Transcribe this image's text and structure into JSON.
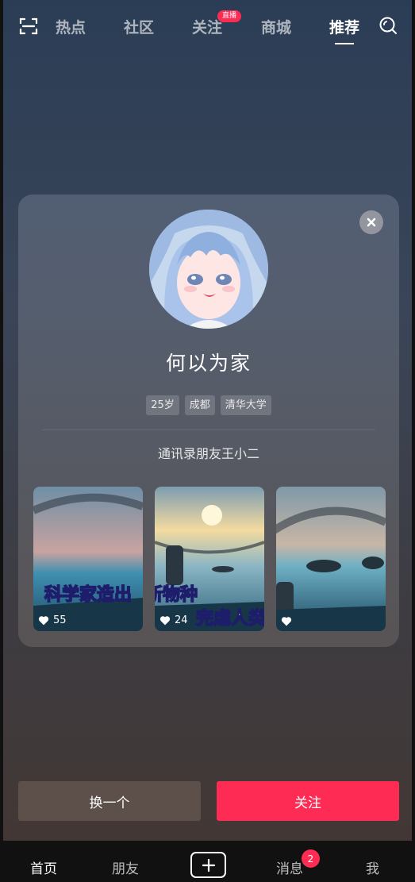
{
  "top_nav": {
    "tabs": [
      {
        "label": "热点"
      },
      {
        "label": "社区"
      },
      {
        "label": "关注",
        "badge": "直播"
      },
      {
        "label": "商城"
      },
      {
        "label": "推荐",
        "active": true
      }
    ],
    "icons": [
      "scan-icon",
      "search-icon"
    ]
  },
  "card": {
    "close_icon": "close-icon",
    "name": "何以为家",
    "tags": [
      "25岁",
      "成都",
      "清华大学"
    ],
    "relation": "通讯录朋友王小二",
    "videos": [
      {
        "likes": "55",
        "caption": "科学家造出"
      },
      {
        "likes": "24",
        "caption": "新物种"
      },
      {
        "likes": "",
        "caption": "完虐人类"
      }
    ]
  },
  "actions": {
    "swap_label": "换一个",
    "follow_label": "关注"
  },
  "tab_bar": {
    "home": "首页",
    "friends": "朋友",
    "add_icon": "plus-icon",
    "messages": "消息",
    "messages_badge": "2",
    "me": "我"
  },
  "colors": {
    "accent": "#fe2c55",
    "tab_bar_bg": "#111111",
    "swap_button": "#5d4f49"
  }
}
